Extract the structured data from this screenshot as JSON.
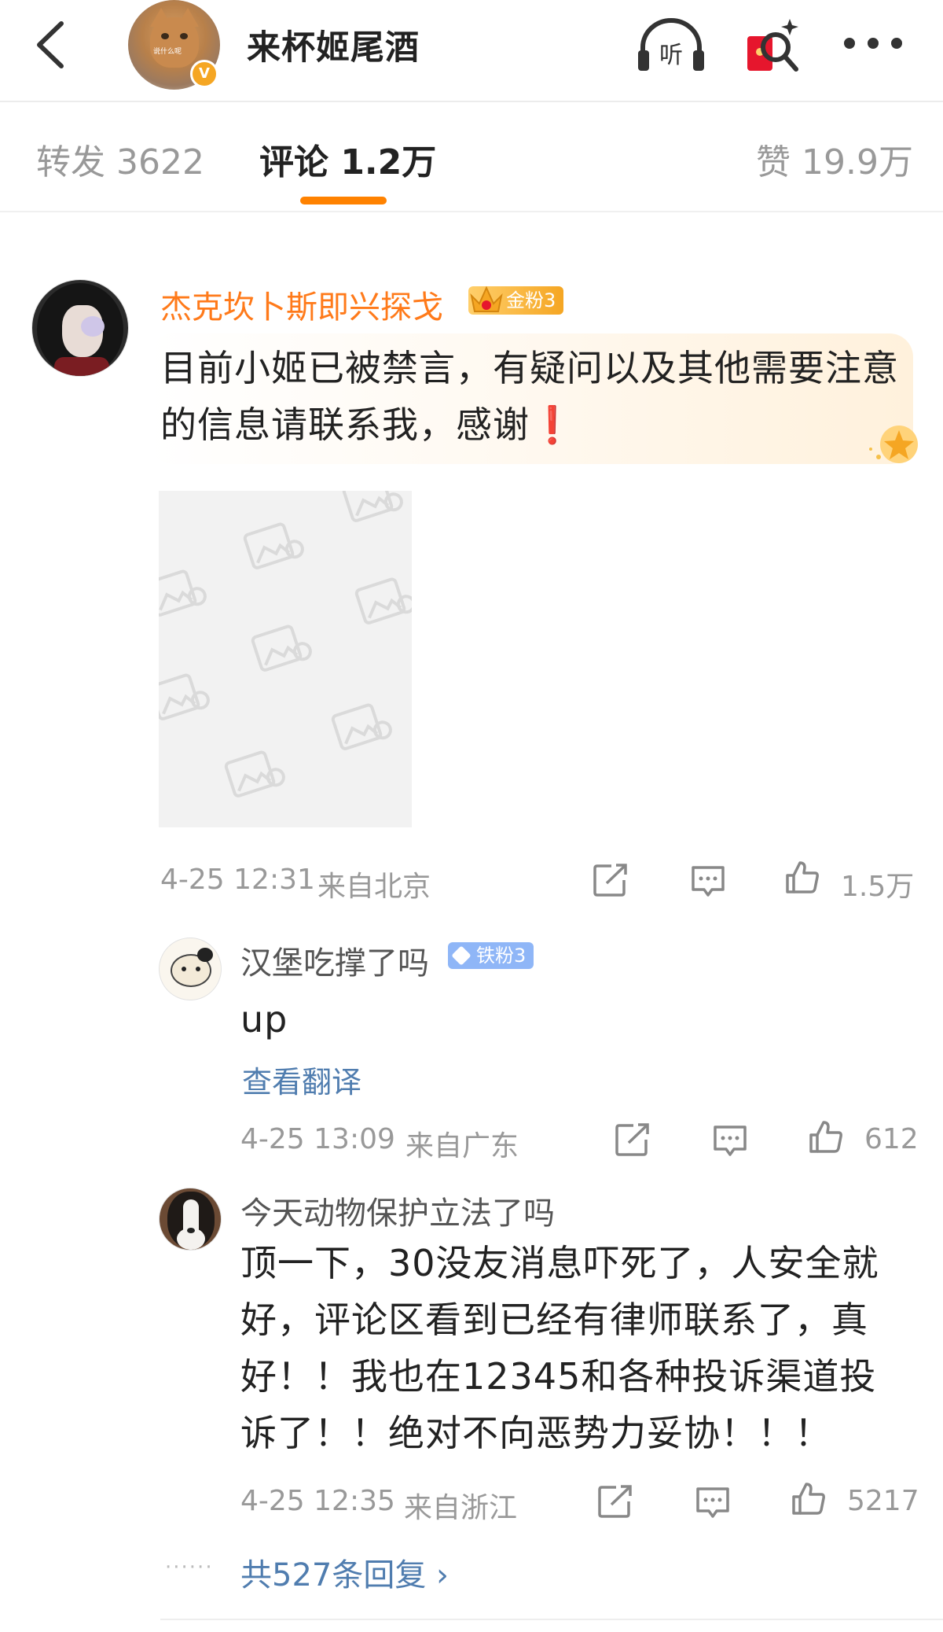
{
  "header": {
    "title": "来杯姬尾酒",
    "avatar_tag": "说什么呢",
    "verified_mark": "V",
    "listen_label": "听"
  },
  "tabs": [
    {
      "label": "转发 3622",
      "active": false
    },
    {
      "label": "评论 1.2万",
      "active": true
    },
    {
      "label": "赞 19.9万",
      "active": false
    }
  ],
  "accent_color": "#ff8200",
  "comment": {
    "username": "杰克坎卜斯即兴探戈",
    "fan_badge": "金粉3",
    "text": "目前小姬已被禁言，有疑问以及其他需要注意的信息请联系我，感谢",
    "emoji": "❗",
    "time": "4-25 12:31",
    "location": "来自北京",
    "likes": "1.5万"
  },
  "replies": [
    {
      "username": "汉堡吃撑了吗",
      "fan_badge": "铁粉3",
      "text": "up",
      "translate": "查看翻译",
      "time": "4-25 13:09",
      "location": "来自广东",
      "likes": "612"
    },
    {
      "username": "今天动物保护立法了吗",
      "text_lines": [
        "顶一下，30没友消息吓死了，人安全就",
        "好，评论区看到已经有律师联系了，真",
        "好！！我也在12345和各种投诉渠道投",
        "诉了！！绝对不向恶势力妥协！！！"
      ],
      "time": "4-25 12:35",
      "location": "来自浙江",
      "likes": "5217"
    }
  ],
  "more_replies": "共527条回复 ›",
  "icons": [
    "back-icon",
    "listen-icon",
    "red-packet-icon",
    "more-icon",
    "share-icon",
    "comment-icon",
    "like-icon",
    "image-placeholder-icon"
  ]
}
